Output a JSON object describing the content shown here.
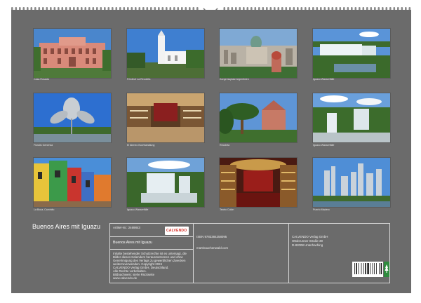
{
  "colors": {
    "page_background": "#6b6b6b",
    "caption_text": "#e8e8e8",
    "calvendo_red": "#d5281f",
    "fsc_green": "#2e8b3e"
  },
  "photos": [
    {
      "caption": "Casa Rosada",
      "icon": "pink-palace-photo"
    },
    {
      "caption": "Friedhof La Recoleta",
      "icon": "white-church-photo"
    },
    {
      "caption": "Kongressplatz Argentinien",
      "icon": "congress-dome-photo"
    },
    {
      "caption": "Iguazu Wasserfälle",
      "icon": "waterfall-photo"
    },
    {
      "caption": "Floralis Generica",
      "icon": "metal-flower-photo"
    },
    {
      "caption": "El Ateneo Buchhandlung",
      "icon": "theatre-bookstore-photo"
    },
    {
      "caption": "Recoleta",
      "icon": "palm-tree-photo"
    },
    {
      "caption": "Iguazu Wasserfälle",
      "icon": "waterfall-photo"
    },
    {
      "caption": "La Boca, Caminito",
      "icon": "colorful-houses-photo"
    },
    {
      "caption": "Iguazu Wasserfälle",
      "icon": "waterfall-photo"
    },
    {
      "caption": "Teatro Colón",
      "icon": "opera-house-photo"
    },
    {
      "caption": "Puerto Madero",
      "icon": "skyline-photo"
    }
  ],
  "calendar": {
    "title": "Buenos Aires mit Iguazu"
  },
  "info": {
    "article_no": "Artikel-Nr.: 2469843",
    "logo": "CALVENDO",
    "subtitle": "Buenos Aires mit Iguazu",
    "copyright_lines": [
      "Inhalte bestehender Schutzrechte ist es untersagt, die",
      "Bilder dieses Kalenders herauszutrennen und ohne",
      "Genehmigung des Verlags zu gewerblichen Zwecken",
      "weiterzuverwenden. Copyright 2024",
      "CALVENDO Verlag GmbH, Deutschland.",
      "Alle Rechte vorbehalten.",
      "Bildnachweis: siehe Rückseite",
      "www.calvendo.de"
    ],
    "isbn": "ISBN 9783384258095",
    "author_site": "martinauchenwald.com",
    "publisher_lines": [
      "CALVENDO Verlag GmbH",
      "Ottobrunner Straße 39",
      "D-82008 Unterhaching"
    ]
  }
}
